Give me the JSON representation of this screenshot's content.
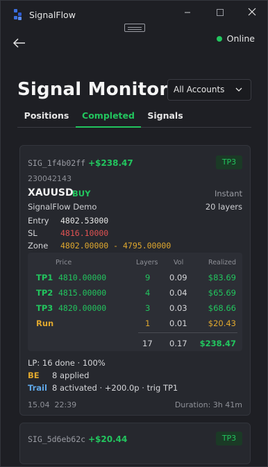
{
  "window": {
    "title": "SignalFlow",
    "minimize_icon": "minimize-icon",
    "maximize_icon": "maximize-icon",
    "close_icon": "close-icon"
  },
  "header": {
    "status": "Online",
    "status_color": "#22c55e",
    "title": "Signal Monitor",
    "account_filter": "All Accounts"
  },
  "tabs": [
    {
      "label": "Positions",
      "active": false
    },
    {
      "label": "Completed",
      "active": true
    },
    {
      "label": "Signals",
      "active": false
    }
  ],
  "colors": {
    "accent": "#22c55e",
    "stop_loss": "#e05252",
    "zone": "#e0a82e",
    "trail": "#5fa8e8",
    "background": "#1e1f24",
    "card": "#26282e"
  },
  "signals": [
    {
      "id": "SIG_1f4b02ff",
      "pnl": "+$238.47",
      "badge": "TP3",
      "ticket": "230042143",
      "symbol": "XAUUSD",
      "side": "BUY",
      "exec_type": "Instant",
      "account": "SignalFlow Demo",
      "layers_label": "20 layers",
      "entry_label": "Entry",
      "entry": "4802.53000",
      "sl_label": "SL",
      "sl": "4816.10000",
      "zone_label": "Zone",
      "zone": "4802.00000 - 4795.00000",
      "table": {
        "headers": {
          "price": "Price",
          "layers": "Layers",
          "vol": "Vol",
          "realized": "Realized"
        },
        "rows": [
          {
            "name": "TP1",
            "price": "4810.00000",
            "layers": "9",
            "vol": "0.09",
            "realized": "$83.69"
          },
          {
            "name": "TP2",
            "price": "4815.00000",
            "layers": "4",
            "vol": "0.04",
            "realized": "$65.69"
          },
          {
            "name": "TP3",
            "price": "4820.00000",
            "layers": "3",
            "vol": "0.03",
            "realized": "$68.66"
          },
          {
            "name": "Run",
            "price": "",
            "layers": "1",
            "vol": "0.01",
            "realized": "$20.43"
          }
        ],
        "totals": {
          "layers": "17",
          "vol": "0.17",
          "realized": "$238.47"
        }
      },
      "lp": "LP: 16 done · 100%",
      "be_label": "BE",
      "be_value": "8 applied",
      "trail_label": "Trail",
      "trail_value": "8 activated · +200.0p · trig TP1",
      "closed_at": "15.04  22:39",
      "duration": "Duration: 3h 41m"
    },
    {
      "id": "SIG_5d6eb62c",
      "pnl": "+$20.44",
      "badge": "TP3"
    }
  ]
}
